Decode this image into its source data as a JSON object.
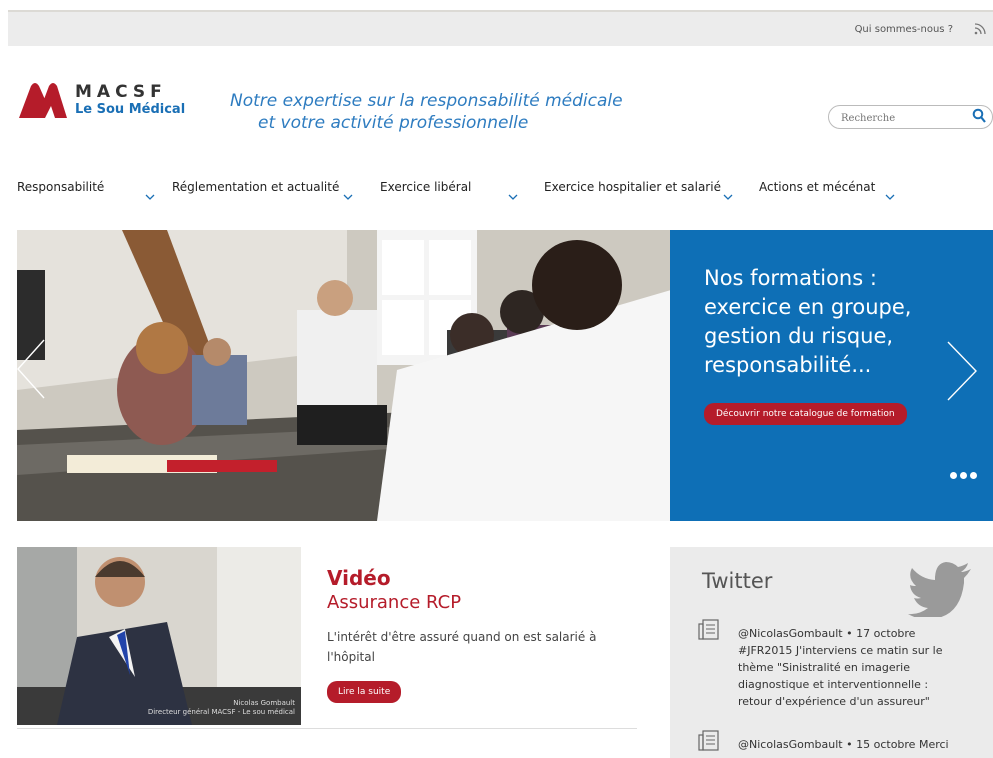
{
  "topbar": {
    "about_link": "Qui sommes-nous ?",
    "rss_icon": "rss-icon"
  },
  "brand": {
    "name": "MACSF",
    "sub": "Le Sou Médical",
    "tagline_line1": "Notre expertise sur la responsabilité médicale",
    "tagline_line2": "et votre activité professionnelle",
    "colors": {
      "red": "#b51c2a",
      "blue": "#0e6fb6"
    }
  },
  "search": {
    "placeholder": "Recherche",
    "icon": "search-icon"
  },
  "nav": [
    {
      "label": "Responsabilité"
    },
    {
      "label": "Réglementation et actualité"
    },
    {
      "label": "Exercice libéral"
    },
    {
      "label": "Exercice hospitalier et salarié"
    },
    {
      "label": "Actions et mécénat"
    }
  ],
  "hero": {
    "title": "Nos formations : exercice en groupe, gestion du risque, responsabilité...",
    "cta": "Découvrir notre catalogue de formation"
  },
  "video": {
    "overlay_name": "Nicolas Gombault",
    "overlay_role": "Directeur général MACSF - Le sou médical",
    "heading": "Vidéo",
    "subheading": "Assurance RCP",
    "description": "L'intérêt d'être assuré quand on est salarié à l'hôpital",
    "button": "Lire la suite"
  },
  "twitter": {
    "title": "Twitter",
    "tweets": [
      {
        "text": "@NicolasGombault • 17 octobre #JFR2015 J'interviens ce matin sur le thème \"Sinistralité en imagerie diagnostique et interventionnelle : retour d'expérience d'un assureur\""
      },
      {
        "text": "@NicolasGombault • 15 octobre Merci"
      }
    ]
  }
}
